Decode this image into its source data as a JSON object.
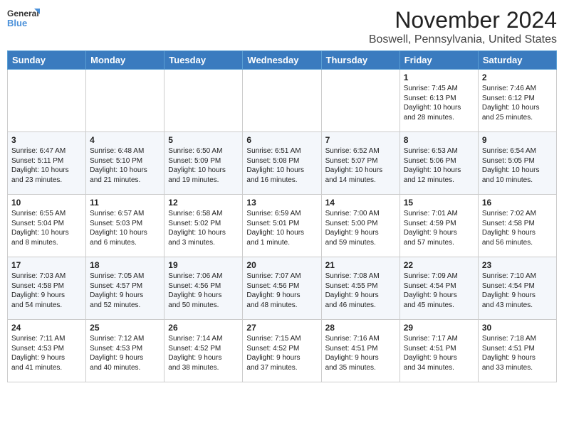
{
  "header": {
    "logo_line1": "General",
    "logo_line2": "Blue",
    "title": "November 2024",
    "subtitle": "Boswell, Pennsylvania, United States"
  },
  "days_of_week": [
    "Sunday",
    "Monday",
    "Tuesday",
    "Wednesday",
    "Thursday",
    "Friday",
    "Saturday"
  ],
  "weeks": [
    [
      {
        "day": "",
        "info": ""
      },
      {
        "day": "",
        "info": ""
      },
      {
        "day": "",
        "info": ""
      },
      {
        "day": "",
        "info": ""
      },
      {
        "day": "",
        "info": ""
      },
      {
        "day": "1",
        "info": "Sunrise: 7:45 AM\nSunset: 6:13 PM\nDaylight: 10 hours\nand 28 minutes."
      },
      {
        "day": "2",
        "info": "Sunrise: 7:46 AM\nSunset: 6:12 PM\nDaylight: 10 hours\nand 25 minutes."
      }
    ],
    [
      {
        "day": "3",
        "info": "Sunrise: 6:47 AM\nSunset: 5:11 PM\nDaylight: 10 hours\nand 23 minutes."
      },
      {
        "day": "4",
        "info": "Sunrise: 6:48 AM\nSunset: 5:10 PM\nDaylight: 10 hours\nand 21 minutes."
      },
      {
        "day": "5",
        "info": "Sunrise: 6:50 AM\nSunset: 5:09 PM\nDaylight: 10 hours\nand 19 minutes."
      },
      {
        "day": "6",
        "info": "Sunrise: 6:51 AM\nSunset: 5:08 PM\nDaylight: 10 hours\nand 16 minutes."
      },
      {
        "day": "7",
        "info": "Sunrise: 6:52 AM\nSunset: 5:07 PM\nDaylight: 10 hours\nand 14 minutes."
      },
      {
        "day": "8",
        "info": "Sunrise: 6:53 AM\nSunset: 5:06 PM\nDaylight: 10 hours\nand 12 minutes."
      },
      {
        "day": "9",
        "info": "Sunrise: 6:54 AM\nSunset: 5:05 PM\nDaylight: 10 hours\nand 10 minutes."
      }
    ],
    [
      {
        "day": "10",
        "info": "Sunrise: 6:55 AM\nSunset: 5:04 PM\nDaylight: 10 hours\nand 8 minutes."
      },
      {
        "day": "11",
        "info": "Sunrise: 6:57 AM\nSunset: 5:03 PM\nDaylight: 10 hours\nand 6 minutes."
      },
      {
        "day": "12",
        "info": "Sunrise: 6:58 AM\nSunset: 5:02 PM\nDaylight: 10 hours\nand 3 minutes."
      },
      {
        "day": "13",
        "info": "Sunrise: 6:59 AM\nSunset: 5:01 PM\nDaylight: 10 hours\nand 1 minute."
      },
      {
        "day": "14",
        "info": "Sunrise: 7:00 AM\nSunset: 5:00 PM\nDaylight: 9 hours\nand 59 minutes."
      },
      {
        "day": "15",
        "info": "Sunrise: 7:01 AM\nSunset: 4:59 PM\nDaylight: 9 hours\nand 57 minutes."
      },
      {
        "day": "16",
        "info": "Sunrise: 7:02 AM\nSunset: 4:58 PM\nDaylight: 9 hours\nand 56 minutes."
      }
    ],
    [
      {
        "day": "17",
        "info": "Sunrise: 7:03 AM\nSunset: 4:58 PM\nDaylight: 9 hours\nand 54 minutes."
      },
      {
        "day": "18",
        "info": "Sunrise: 7:05 AM\nSunset: 4:57 PM\nDaylight: 9 hours\nand 52 minutes."
      },
      {
        "day": "19",
        "info": "Sunrise: 7:06 AM\nSunset: 4:56 PM\nDaylight: 9 hours\nand 50 minutes."
      },
      {
        "day": "20",
        "info": "Sunrise: 7:07 AM\nSunset: 4:56 PM\nDaylight: 9 hours\nand 48 minutes."
      },
      {
        "day": "21",
        "info": "Sunrise: 7:08 AM\nSunset: 4:55 PM\nDaylight: 9 hours\nand 46 minutes."
      },
      {
        "day": "22",
        "info": "Sunrise: 7:09 AM\nSunset: 4:54 PM\nDaylight: 9 hours\nand 45 minutes."
      },
      {
        "day": "23",
        "info": "Sunrise: 7:10 AM\nSunset: 4:54 PM\nDaylight: 9 hours\nand 43 minutes."
      }
    ],
    [
      {
        "day": "24",
        "info": "Sunrise: 7:11 AM\nSunset: 4:53 PM\nDaylight: 9 hours\nand 41 minutes."
      },
      {
        "day": "25",
        "info": "Sunrise: 7:12 AM\nSunset: 4:53 PM\nDaylight: 9 hours\nand 40 minutes."
      },
      {
        "day": "26",
        "info": "Sunrise: 7:14 AM\nSunset: 4:52 PM\nDaylight: 9 hours\nand 38 minutes."
      },
      {
        "day": "27",
        "info": "Sunrise: 7:15 AM\nSunset: 4:52 PM\nDaylight: 9 hours\nand 37 minutes."
      },
      {
        "day": "28",
        "info": "Sunrise: 7:16 AM\nSunset: 4:51 PM\nDaylight: 9 hours\nand 35 minutes."
      },
      {
        "day": "29",
        "info": "Sunrise: 7:17 AM\nSunset: 4:51 PM\nDaylight: 9 hours\nand 34 minutes."
      },
      {
        "day": "30",
        "info": "Sunrise: 7:18 AM\nSunset: 4:51 PM\nDaylight: 9 hours\nand 33 minutes."
      }
    ]
  ]
}
